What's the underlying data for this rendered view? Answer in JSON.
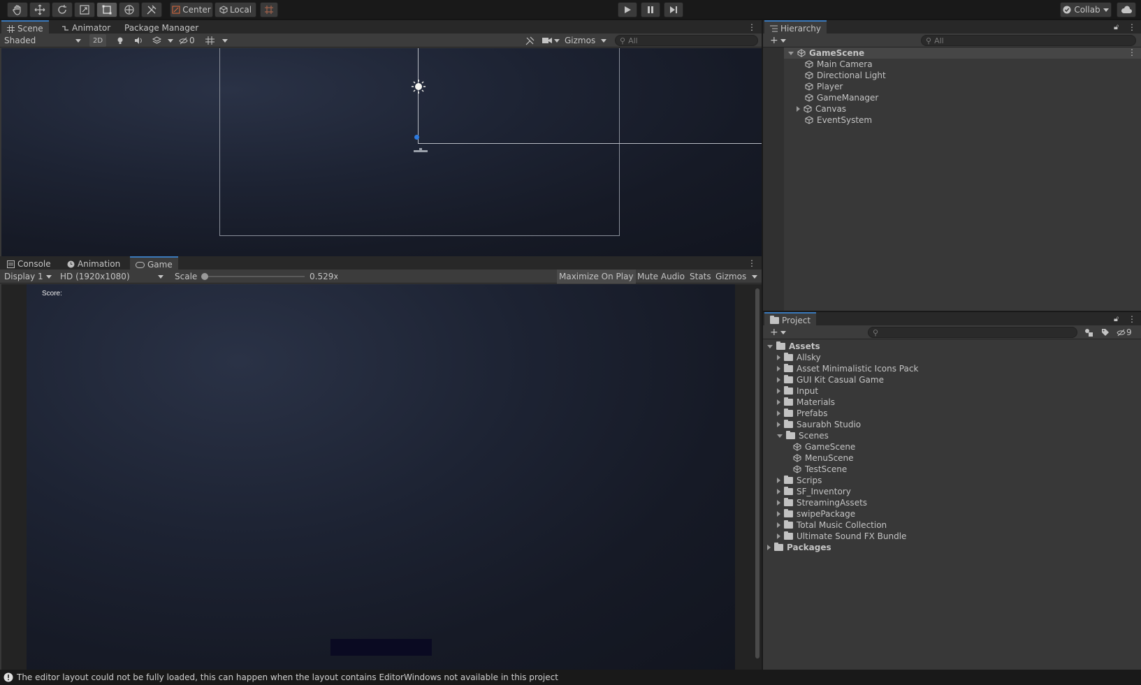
{
  "toolbar": {
    "center_label": "Center",
    "local_label": "Local",
    "collab_label": "Collab"
  },
  "scene_panel": {
    "tabs": [
      "Scene",
      "Animator",
      "Package Manager"
    ],
    "shading_mode": "Shaded",
    "mode_2d_label": "2D",
    "hidden_count": "0",
    "gizmos_label": "Gizmos",
    "search_placeholder": "All"
  },
  "game_panel": {
    "tabs": [
      "Console",
      "Animation",
      "Game"
    ],
    "display": "Display 1",
    "resolution": "HD (1920x1080)",
    "scale_label": "Scale",
    "scale_value": "0.529x",
    "maximize_label": "Maximize On Play",
    "mute_label": "Mute Audio",
    "stats_label": "Stats",
    "gizmos_label": "Gizmos",
    "score_text": "Score:"
  },
  "hierarchy": {
    "title": "Hierarchy",
    "search_placeholder": "All",
    "root": "GameScene",
    "items": [
      "Main Camera",
      "Directional Light",
      "Player",
      "GameManager",
      "Canvas",
      "EventSystem"
    ]
  },
  "project": {
    "title": "Project",
    "hidden_count": "9",
    "root": "Assets",
    "folders": [
      "Allsky",
      "Asset Minimalistic Icons Pack",
      "GUI Kit Casual Game",
      "Input",
      "Materials",
      "Prefabs",
      "Saurabh Studio",
      "Scenes"
    ],
    "scenes": [
      "GameScene",
      "MenuScene",
      "TestScene"
    ],
    "folders_after": [
      "Scrips",
      "SF_Inventory",
      "StreamingAssets",
      "swipePackage",
      "Total Music Collection",
      "Ultimate Sound FX Bundle"
    ],
    "packages": "Packages"
  },
  "status_bar": {
    "message": "The editor layout could not be fully loaded, this can happen when the layout contains EditorWindows not available in this project"
  },
  "colors": {
    "accent": "#3a79bb",
    "panel": "#383838",
    "toolbar": "#191919"
  }
}
